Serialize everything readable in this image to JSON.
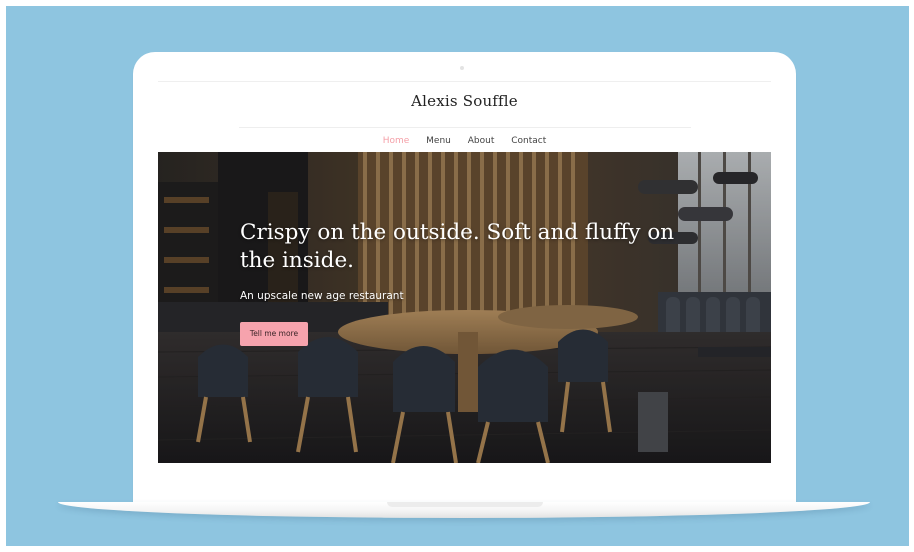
{
  "site": {
    "title": "Alexis Souffle"
  },
  "nav": {
    "items": [
      "Home",
      "Menu",
      "About",
      "Contact"
    ],
    "active": "Home"
  },
  "hero": {
    "headline": "Crispy on the outside. Soft and fluffy on the inside.",
    "subheadline": "An upscale new age restaurant",
    "cta_label": "Tell me more",
    "image": "restaurant-interior-photo"
  },
  "colors": {
    "backdrop": "#8ec5e0",
    "accent": "#f6a3ad",
    "nav_active": "#f5a0a8",
    "text_dark": "#222222"
  }
}
